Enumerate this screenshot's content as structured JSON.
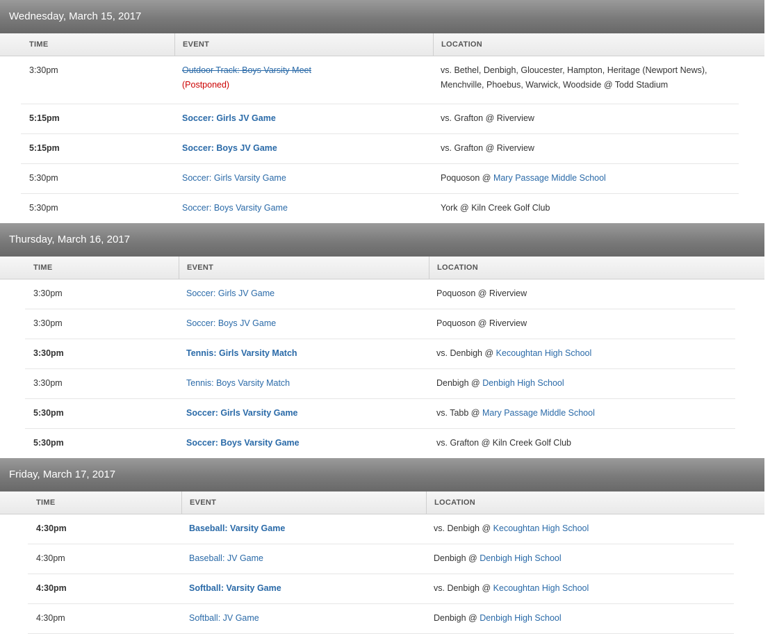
{
  "columns": {
    "time": "TIME",
    "event": "EVENT",
    "location": "LOCATION"
  },
  "days": [
    {
      "date": "Wednesday, March 15, 2017",
      "rows": [
        {
          "time": "3:30pm",
          "event": "Outdoor Track: Boys Varsity Meet",
          "status": "(Postponed)",
          "loc_text": "vs. Bethel, Denbigh, Gloucester, Hampton, Heritage (Newport News),",
          "loc_text2": "Menchville, Phoebus, Warwick, Woodside  @ Todd Stadium",
          "venue": ""
        },
        {
          "time": "5:15pm",
          "event": "Soccer: Girls JV Game",
          "loc_text": "vs. Grafton  @ Riverview",
          "venue": ""
        },
        {
          "time": "5:15pm",
          "event": "Soccer: Boys JV Game",
          "loc_text": "vs. Grafton  @ Riverview",
          "venue": ""
        },
        {
          "time": "5:30pm",
          "event": "Soccer: Girls Varsity Game",
          "loc_text": "Poquoson  @ ",
          "venue": "Mary Passage Middle School"
        },
        {
          "time": "5:30pm",
          "event": "Soccer: Boys Varsity Game",
          "loc_text": "York  @ Kiln Creek Golf Club",
          "venue": ""
        }
      ]
    },
    {
      "date": "Thursday, March 16, 2017",
      "rows": [
        {
          "time": "3:30pm",
          "event": "Soccer: Girls JV Game",
          "loc_text": "Poquoson  @ Riverview",
          "venue": ""
        },
        {
          "time": "3:30pm",
          "event": "Soccer: Boys JV Game",
          "loc_text": "Poquoson  @ Riverview",
          "venue": ""
        },
        {
          "time": "3:30pm",
          "event": "Tennis: Girls Varsity Match",
          "loc_text": "vs. Denbigh  @ ",
          "venue": "Kecoughtan High School"
        },
        {
          "time": "3:30pm",
          "event": "Tennis: Boys Varsity Match",
          "loc_text": "Denbigh  @ ",
          "venue": "Denbigh High School"
        },
        {
          "time": "5:30pm",
          "event": "Soccer: Girls Varsity Game",
          "loc_text": "vs. Tabb  @ ",
          "venue": "Mary Passage Middle School"
        },
        {
          "time": "5:30pm",
          "event": "Soccer: Boys Varsity Game",
          "loc_text": "vs. Grafton  @ Kiln Creek Golf Club",
          "venue": ""
        }
      ]
    },
    {
      "date": "Friday, March 17, 2017",
      "rows": [
        {
          "time": "4:30pm",
          "event": "Baseball: Varsity Game",
          "loc_text": "vs. Denbigh  @ ",
          "venue": "Kecoughtan High School"
        },
        {
          "time": "4:30pm",
          "event": "Baseball: JV Game",
          "loc_text": "Denbigh  @ ",
          "venue": "Denbigh High School"
        },
        {
          "time": "4:30pm",
          "event": "Softball: Varsity Game",
          "loc_text": "vs. Denbigh  @ ",
          "venue": "Kecoughtan High School"
        },
        {
          "time": "4:30pm",
          "event": "Softball: JV Game",
          "loc_text": "Denbigh  @ ",
          "venue": "Denbigh High School"
        }
      ]
    }
  ]
}
